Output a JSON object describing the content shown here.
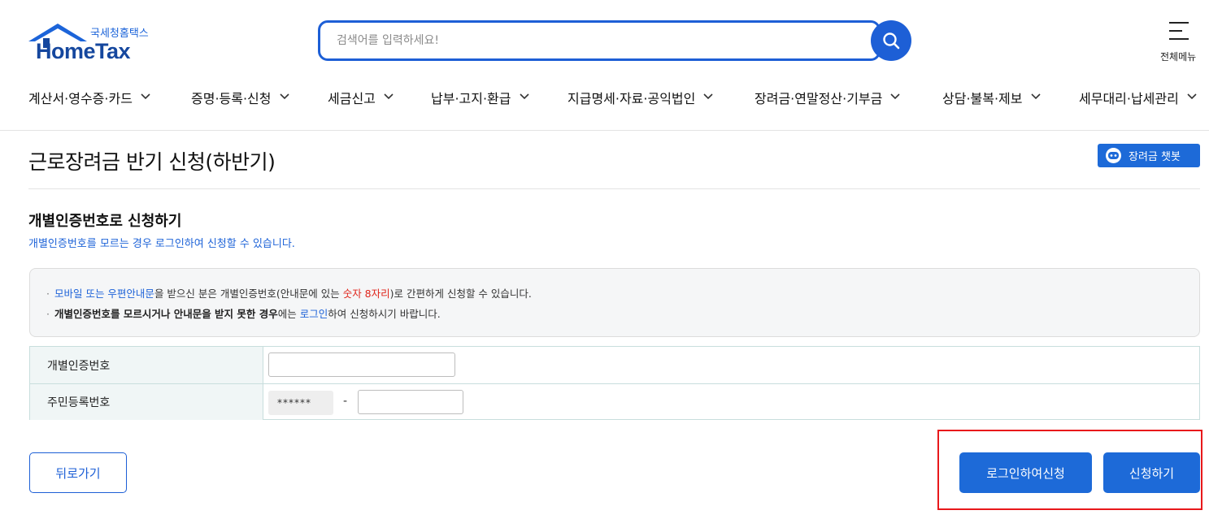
{
  "header": {
    "logo_sub": "국세청홈택스",
    "logo_main": "HomeTax",
    "search_placeholder": "검색어를 입력하세요!",
    "all_menu_label": "전체메뉴"
  },
  "nav": {
    "items": [
      {
        "label": "계산서·영수증·카드"
      },
      {
        "label": "증명·등록·신청"
      },
      {
        "label": "세금신고"
      },
      {
        "label": "납부·고지·환급"
      },
      {
        "label": "지급명세·자료·공익법인"
      },
      {
        "label": "장려금·연말정산·기부금"
      },
      {
        "label": "상담·불복·제보"
      },
      {
        "label": "세무대리·납세관리"
      }
    ]
  },
  "page": {
    "title": "근로장려금 반기 신청(하반기)",
    "chatbot_label": "장려금 챗봇"
  },
  "section": {
    "title": "개별인증번호로 신청하기",
    "subtitle": "개별인증번호를 모르는 경우 로그인하여 신청할 수 있습니다."
  },
  "notice": {
    "line1": {
      "part1": "모바일 또는 우편안내문",
      "part2": "을 받으신 분은 개별인증번호(안내문에 있는 ",
      "part3": "숫자 8자리",
      "part4": ")로 간편하게 신청할 수 있습니다."
    },
    "line2": {
      "part1": "개별인증번호를 모르시거나 안내문을 받지 못한 경우",
      "part2": "에는 ",
      "part3": "로그인",
      "part4": "하여 신청하시기 바랍니다."
    }
  },
  "form": {
    "auth_label": "개별인증번호",
    "auth_value": "",
    "rrn_label": "주민등록번호",
    "rrn_front_masked": "******",
    "rrn_separator": "-",
    "rrn_back_value": ""
  },
  "buttons": {
    "back": "뒤로가기",
    "login_apply": "로그인하여신청",
    "apply": "신청하기"
  },
  "colors": {
    "brand_blue": "#1d5fd6",
    "logo_navy": "#15479e",
    "highlight_red": "#e8181b"
  }
}
